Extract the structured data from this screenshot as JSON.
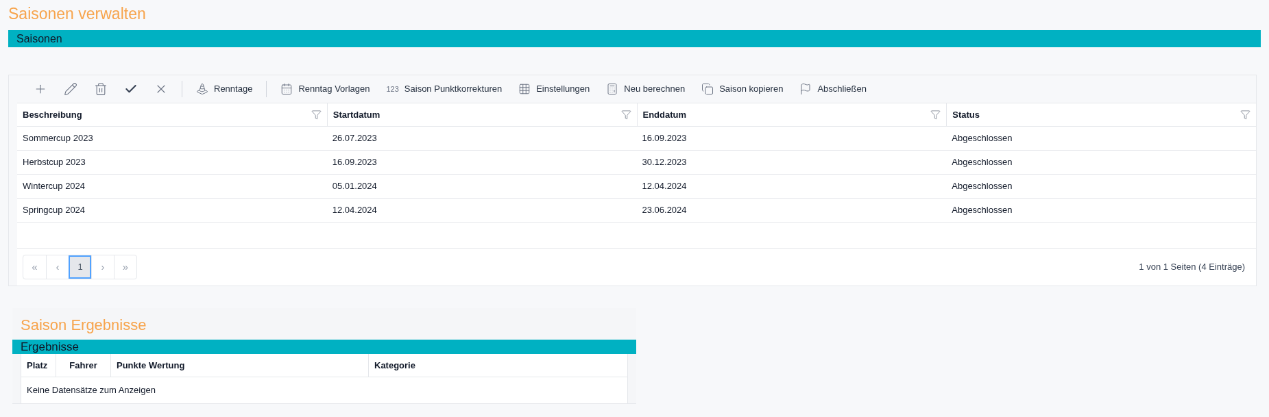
{
  "page_title": "Saisonen verwalten",
  "seasons_panel": {
    "header": "Saisonen",
    "toolbar": [
      {
        "kind": "add"
      },
      {
        "kind": "edit"
      },
      {
        "kind": "delete"
      },
      {
        "kind": "save"
      },
      {
        "kind": "cancel"
      },
      {
        "kind": "separator"
      },
      {
        "kind": "renntage",
        "label": "Renntage"
      },
      {
        "kind": "separator"
      },
      {
        "kind": "calendar",
        "label": "Renntag Vorlagen"
      },
      {
        "kind": "numbers",
        "glyph": "123",
        "label": "Saison Punktkorrekturen"
      },
      {
        "kind": "settings",
        "label": "Einstellungen"
      },
      {
        "kind": "calculator",
        "label": "Neu berechnen"
      },
      {
        "kind": "copy",
        "label": "Saison kopieren"
      },
      {
        "kind": "flag",
        "label": "Abschließen"
      }
    ],
    "columns": [
      "Beschreibung",
      "Startdatum",
      "Enddatum",
      "Status"
    ],
    "rows": [
      [
        "Sommercup 2023",
        "26.07.2023",
        "16.09.2023",
        "Abgeschlossen"
      ],
      [
        "Herbstcup 2023",
        "16.09.2023",
        "30.12.2023",
        "Abgeschlossen"
      ],
      [
        "Wintercup 2024",
        "05.01.2024",
        "12.04.2024",
        "Abgeschlossen"
      ],
      [
        "Springcup 2024",
        "12.04.2024",
        "23.06.2024",
        "Abgeschlossen"
      ]
    ],
    "pager": [
      {
        "label": "«",
        "selected": false,
        "disabled": true
      },
      {
        "label": "‹",
        "selected": false,
        "disabled": true
      },
      {
        "label": "1",
        "selected": true,
        "disabled": false
      },
      {
        "label": "›",
        "selected": false,
        "disabled": true
      },
      {
        "label": "»",
        "selected": false,
        "disabled": true
      }
    ],
    "page_info": "1 von 1 Seiten (4 Einträge)"
  },
  "results_section": {
    "title": "Saison Ergebnisse",
    "header": "Ergebnisse",
    "columns": [
      "Platz",
      "Fahrer",
      "Punkte Wertung",
      "Kategorie"
    ],
    "empty_text": "Keine Datensätze zum Anzeigen"
  }
}
